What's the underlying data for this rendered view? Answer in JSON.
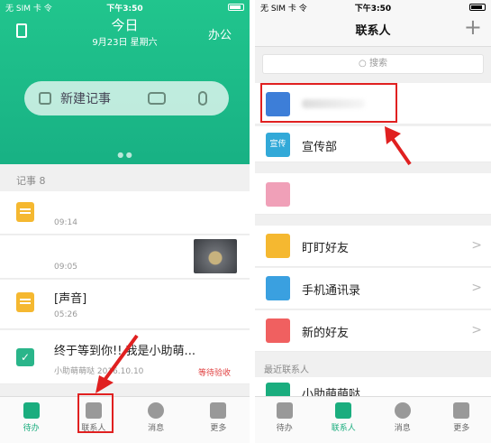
{
  "left": {
    "status": {
      "carrier": "无 SIM 卡 令",
      "time": "下午3:50"
    },
    "header": {
      "title": "今日",
      "date": "9月23日 星期六",
      "office": "办公"
    },
    "new_note": {
      "label": "新建记事"
    },
    "section": {
      "label": "记事 8"
    },
    "notes": [
      {
        "title": "",
        "time": "09:14"
      },
      {
        "title": "",
        "time": "09:05"
      },
      {
        "title": "[声音]",
        "time": "05:26"
      },
      {
        "title": "终于等到你!! 我是小助萌...",
        "meta": "小助萌萌哒 2016.10.10",
        "badge": "等待验收"
      }
    ],
    "tabs": [
      {
        "label": "待办"
      },
      {
        "label": "联系人"
      },
      {
        "label": "消息"
      },
      {
        "label": "更多"
      }
    ]
  },
  "right": {
    "status": {
      "carrier": "无 SIM 卡 令",
      "time": "下午3:50"
    },
    "header": {
      "title": "联系人",
      "add": "+"
    },
    "search": {
      "placeholder": "搜索"
    },
    "rows": [
      {
        "label": "",
        "icon_text": ""
      },
      {
        "label": "宣传部",
        "icon_text": "宣传"
      },
      {
        "label": "",
        "icon_text": ""
      },
      {
        "label": "盯盯好友",
        "chevron": ">"
      },
      {
        "label": "手机通讯录",
        "chevron": ">"
      },
      {
        "label": "新的好友",
        "chevron": ">"
      }
    ],
    "recent_section": {
      "label": "最近联系人"
    },
    "recent": [
      {
        "label": "小助萌萌哒"
      }
    ],
    "tabs": [
      {
        "label": "待办"
      },
      {
        "label": "联系人"
      },
      {
        "label": "消息"
      },
      {
        "label": "更多"
      }
    ]
  }
}
